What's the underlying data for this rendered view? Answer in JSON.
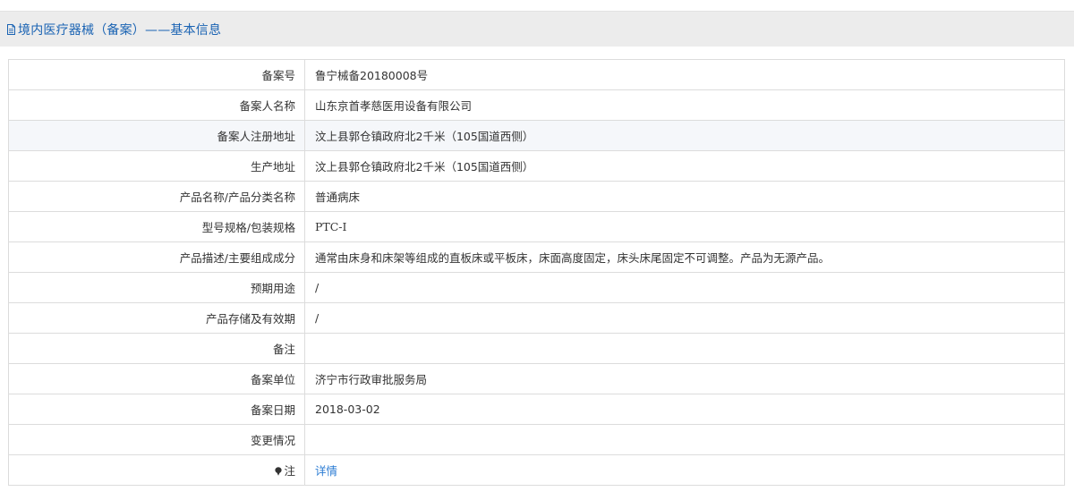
{
  "header": {
    "title": "境内医疗器械（备案）——基本信息"
  },
  "rows": [
    {
      "label": "备案号",
      "value": "鲁宁械备20180008号"
    },
    {
      "label": "备案人名称",
      "value": "山东京首孝慈医用设备有限公司"
    },
    {
      "label": "备案人注册地址",
      "value": "汶上县郭仓镇政府北2千米（105国道西侧）"
    },
    {
      "label": "生产地址",
      "value": "汶上县郭仓镇政府北2千米（105国道西侧）"
    },
    {
      "label": "产品名称/产品分类名称",
      "value": "普通病床"
    },
    {
      "label": "型号规格/包装规格",
      "value": "PTC-I"
    },
    {
      "label": "产品描述/主要组成成分",
      "value": "通常由床身和床架等组成的直板床或平板床，床面高度固定，床头床尾固定不可调整。产品为无源产品。"
    },
    {
      "label": "预期用途",
      "value": "/"
    },
    {
      "label": "产品存储及有效期",
      "value": "/"
    },
    {
      "label": "备注",
      "value": ""
    },
    {
      "label": "备案单位",
      "value": "济宁市行政审批服务局"
    },
    {
      "label": "备案日期",
      "value": "2018-03-02"
    },
    {
      "label": "变更情况",
      "value": ""
    },
    {
      "label": "注",
      "value": "详情",
      "icon": "pin-icon"
    }
  ],
  "colors": {
    "header_text": "#1a63b3",
    "link": "#2a7bd3",
    "header_bg": "#ececec",
    "alt_row_bg": "#f5f7fa",
    "border": "#dcdcdc"
  }
}
